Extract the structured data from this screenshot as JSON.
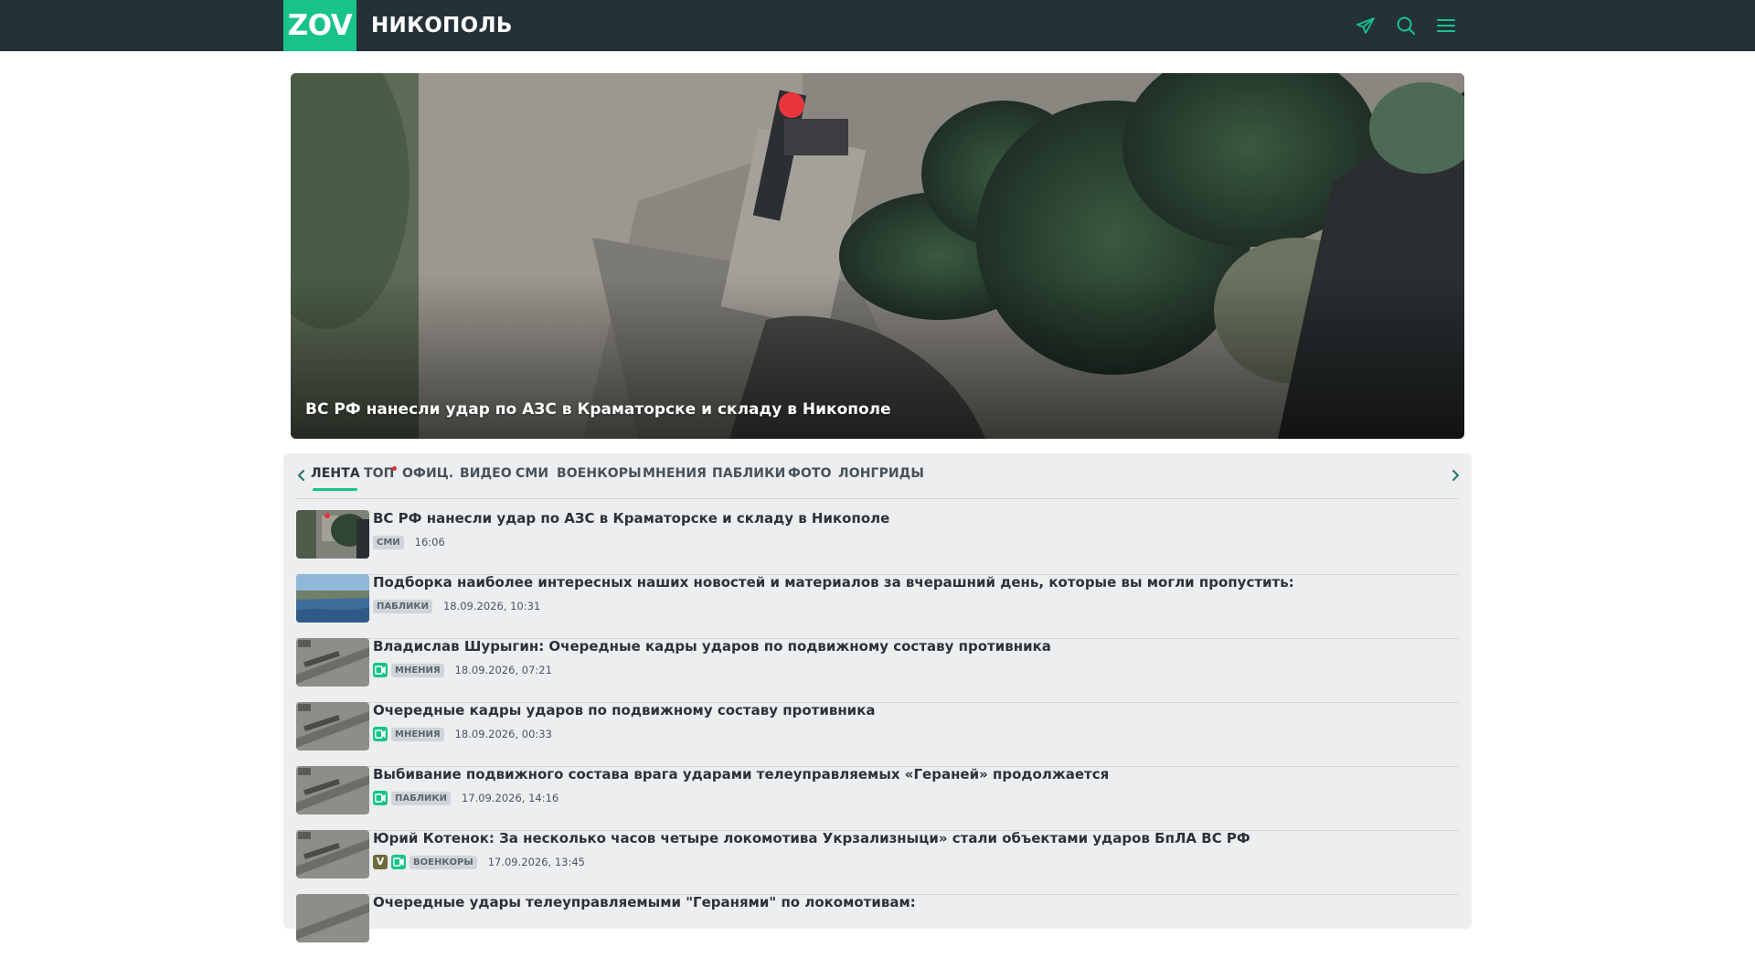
{
  "header": {
    "logo": "ZOV",
    "city": "НИКОПОЛЬ",
    "icons": [
      "telegram-icon",
      "search-icon",
      "menu-icon"
    ],
    "background": "#243139",
    "accent": "#17c38a"
  },
  "hero": {
    "title": "ВС РФ нанесли удар по АЗС в Краматорске и складу в Никополе"
  },
  "tabs": {
    "items": [
      "ЛЕНТА",
      "ТОП",
      "ОФИЦ.",
      "ВИДЕО",
      "СМИ",
      "ВОЕНКОРЫ",
      "МНЕНИЯ",
      "ПАБЛИКИ",
      "ФОТО",
      "ЛОНГРИДЫ"
    ],
    "active": "ЛЕНТА"
  },
  "news": [
    {
      "title": "ВС РФ нанесли удар по АЗС в Краматорске и складу в Никополе",
      "badge": "СМИ",
      "time": "16:06",
      "video": false,
      "v": false
    },
    {
      "title": "Подборка наиболее интересных наших новостей и материалов за вчерашний день, которые вы могли пропустить:",
      "badge": "ПАБЛИКИ",
      "time": "18.09.2026, 10:31",
      "video": false,
      "v": false
    },
    {
      "title": "Владислав Шурыгин: Очередные кадры ударов по подвижному составу противника",
      "badge": "МНЕНИЯ",
      "time": "18.09.2026, 07:21",
      "video": true,
      "v": false
    },
    {
      "title": "Очередные кадры ударов по подвижному составу противника",
      "badge": "МНЕНИЯ",
      "time": "18.09.2026, 00:33",
      "video": true,
      "v": false
    },
    {
      "title": "Выбивание подвижного состава врага ударами телеуправляемых «Гераней» продолжается",
      "badge": "ПАБЛИКИ",
      "time": "17.09.2026, 14:16",
      "video": true,
      "v": false
    },
    {
      "title": "Юрий Котенок: За несколько часов четыре локомотива Укрзализныци» стали объектами ударов БпЛА ВС РФ",
      "badge": "ВОЕНКОРЫ",
      "time": "17.09.2026, 13:45",
      "video": true,
      "v": true,
      "v_label": "V"
    },
    {
      "title": "Очередные удары телеуправляемыми \"Геранями\" по локомотивам:",
      "badge": "",
      "time": "",
      "video": false,
      "v": false
    }
  ]
}
